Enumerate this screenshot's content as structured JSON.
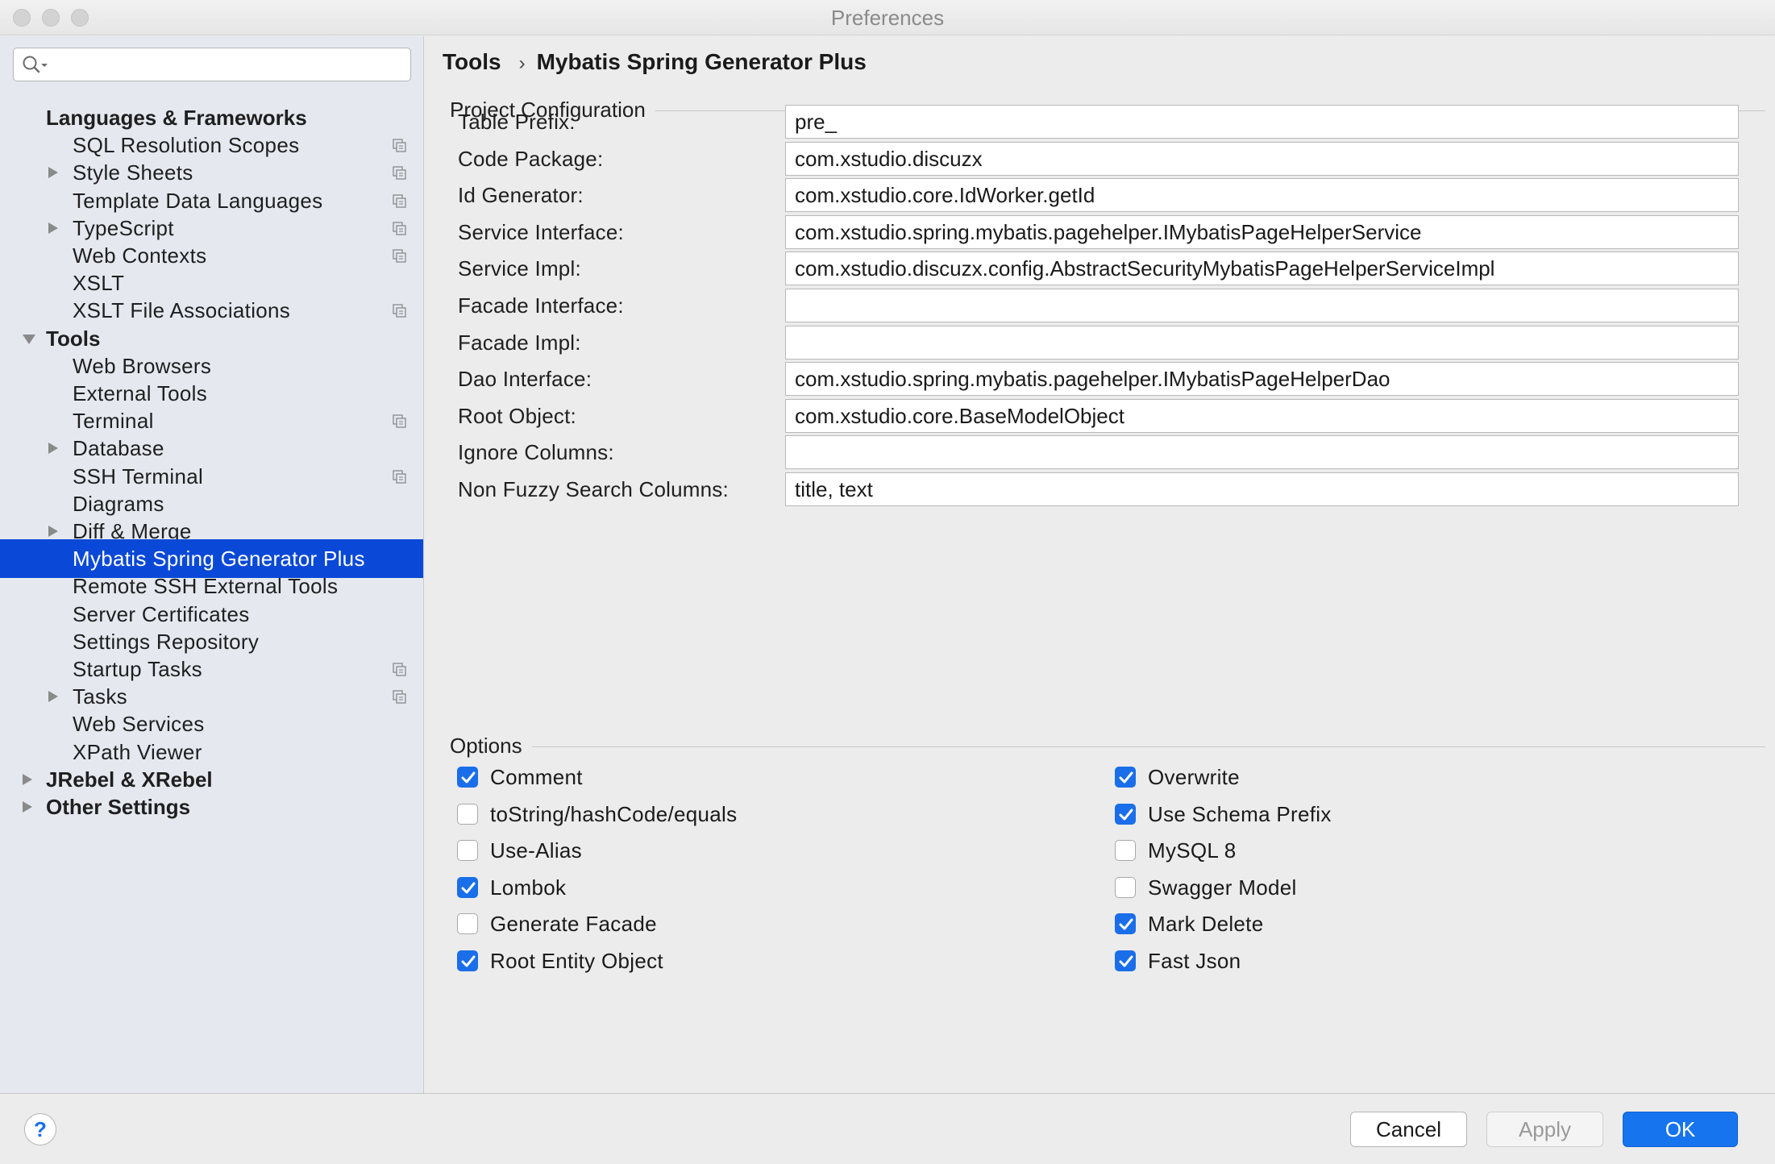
{
  "window": {
    "title": "Preferences"
  },
  "sidebar": {
    "search": {
      "placeholder": "",
      "value": ""
    },
    "items": [
      {
        "label": "Languages & Frameworks",
        "level": 0,
        "expander": "none",
        "project_icon": false
      },
      {
        "label": "SQL Resolution Scopes",
        "level": 1,
        "expander": "none",
        "project_icon": true
      },
      {
        "label": "Style Sheets",
        "level": 1,
        "expander": "collapsed",
        "project_icon": true
      },
      {
        "label": "Template Data Languages",
        "level": 1,
        "expander": "none",
        "project_icon": true
      },
      {
        "label": "TypeScript",
        "level": 1,
        "expander": "collapsed",
        "project_icon": true
      },
      {
        "label": "Web Contexts",
        "level": 1,
        "expander": "none",
        "project_icon": true
      },
      {
        "label": "XSLT",
        "level": 1,
        "expander": "none",
        "project_icon": false
      },
      {
        "label": "XSLT File Associations",
        "level": 1,
        "expander": "none",
        "project_icon": true
      },
      {
        "label": "Tools",
        "level": 0,
        "expander": "expanded",
        "project_icon": false
      },
      {
        "label": "Web Browsers",
        "level": 1,
        "expander": "none",
        "project_icon": false
      },
      {
        "label": "External Tools",
        "level": 1,
        "expander": "none",
        "project_icon": false
      },
      {
        "label": "Terminal",
        "level": 1,
        "expander": "none",
        "project_icon": true
      },
      {
        "label": "Database",
        "level": 1,
        "expander": "collapsed",
        "project_icon": false
      },
      {
        "label": "SSH Terminal",
        "level": 1,
        "expander": "none",
        "project_icon": true
      },
      {
        "label": "Diagrams",
        "level": 1,
        "expander": "none",
        "project_icon": false
      },
      {
        "label": "Diff & Merge",
        "level": 1,
        "expander": "collapsed",
        "project_icon": false
      },
      {
        "label": "Mybatis Spring Generator Plus",
        "level": 1,
        "expander": "none",
        "project_icon": false,
        "selected": true
      },
      {
        "label": "Remote SSH External Tools",
        "level": 1,
        "expander": "none",
        "project_icon": false
      },
      {
        "label": "Server Certificates",
        "level": 1,
        "expander": "none",
        "project_icon": false
      },
      {
        "label": "Settings Repository",
        "level": 1,
        "expander": "none",
        "project_icon": false
      },
      {
        "label": "Startup Tasks",
        "level": 1,
        "expander": "none",
        "project_icon": true
      },
      {
        "label": "Tasks",
        "level": 1,
        "expander": "collapsed",
        "project_icon": true
      },
      {
        "label": "Web Services",
        "level": 1,
        "expander": "none",
        "project_icon": false
      },
      {
        "label": "XPath Viewer",
        "level": 1,
        "expander": "none",
        "project_icon": false
      },
      {
        "label": "JRebel & XRebel",
        "level": 0,
        "expander": "collapsed",
        "project_icon": false
      },
      {
        "label": "Other Settings",
        "level": 0,
        "expander": "collapsed",
        "project_icon": false
      }
    ]
  },
  "breadcrumb": {
    "parent": "Tools",
    "separator": "›",
    "current": "Mybatis Spring Generator Plus"
  },
  "project_config": {
    "title": "Project Configuration",
    "fields": [
      {
        "label": "Table Prefix:",
        "value": "pre_"
      },
      {
        "label": "Code Package:",
        "value": "com.xstudio.discuzx"
      },
      {
        "label": "Id Generator:",
        "value": "com.xstudio.core.IdWorker.getId"
      },
      {
        "label": "Service Interface:",
        "value": "com.xstudio.spring.mybatis.pagehelper.IMybatisPageHelperService"
      },
      {
        "label": "Service Impl:",
        "value": "com.xstudio.discuzx.config.AbstractSecurityMybatisPageHelperServiceImpl"
      },
      {
        "label": "Facade Interface:",
        "value": ""
      },
      {
        "label": "Facade Impl:",
        "value": ""
      },
      {
        "label": "Dao Interface:",
        "value": "com.xstudio.spring.mybatis.pagehelper.IMybatisPageHelperDao"
      },
      {
        "label": "Root Object:",
        "value": "com.xstudio.core.BaseModelObject"
      },
      {
        "label": "Ignore Columns:",
        "value": ""
      },
      {
        "label": "Non Fuzzy Search Columns:",
        "value": "title, text"
      }
    ]
  },
  "options": {
    "title": "Options",
    "left": [
      {
        "label": "Comment",
        "checked": true
      },
      {
        "label": "toString/hashCode/equals",
        "checked": false
      },
      {
        "label": "Use-Alias",
        "checked": false
      },
      {
        "label": "Lombok",
        "checked": true
      },
      {
        "label": "Generate Facade",
        "checked": false
      },
      {
        "label": "Root Entity Object",
        "checked": true
      }
    ],
    "right": [
      {
        "label": "Overwrite",
        "checked": true
      },
      {
        "label": "Use Schema Prefix",
        "checked": true
      },
      {
        "label": "MySQL 8",
        "checked": false
      },
      {
        "label": "Swagger Model",
        "checked": false
      },
      {
        "label": "Mark Delete",
        "checked": true
      },
      {
        "label": "Fast Json",
        "checked": true
      }
    ]
  },
  "footer": {
    "help_label": "?",
    "cancel_label": "Cancel",
    "apply_label": "Apply",
    "ok_label": "OK"
  },
  "colors": {
    "selection": "#0a49d7",
    "checkbox_on": "#1a6ee9",
    "ok_button": "#1674ee",
    "sidebar_bg": "#e5e9ef"
  }
}
